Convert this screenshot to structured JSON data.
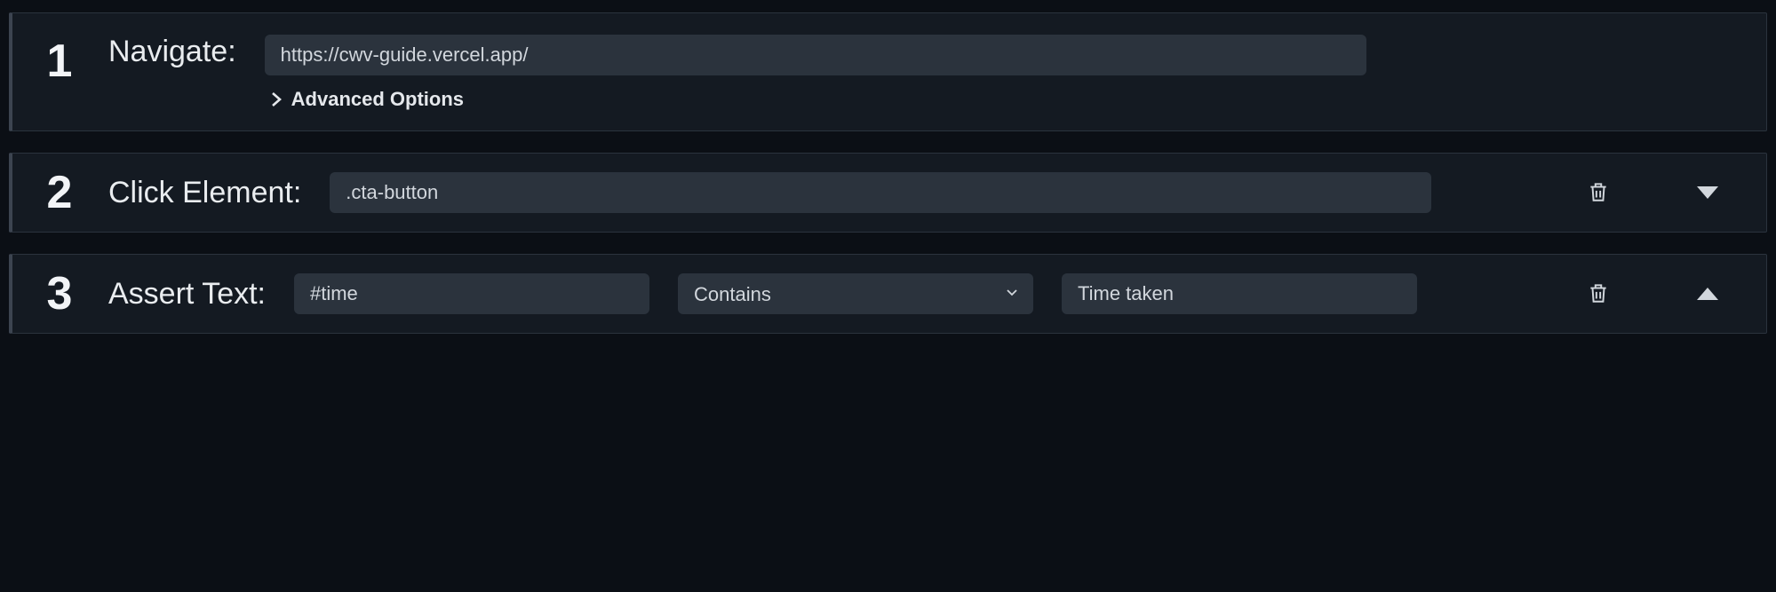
{
  "steps": [
    {
      "number": "1",
      "label": "Navigate:",
      "url_input": "https://cwv-guide.vercel.app/",
      "advanced_label": "Advanced Options"
    },
    {
      "number": "2",
      "label": "Click Element:",
      "selector_input": ".cta-button"
    },
    {
      "number": "3",
      "label": "Assert Text:",
      "selector_input": "#time",
      "match_mode": "Contains",
      "expected_text": "Time taken"
    }
  ]
}
